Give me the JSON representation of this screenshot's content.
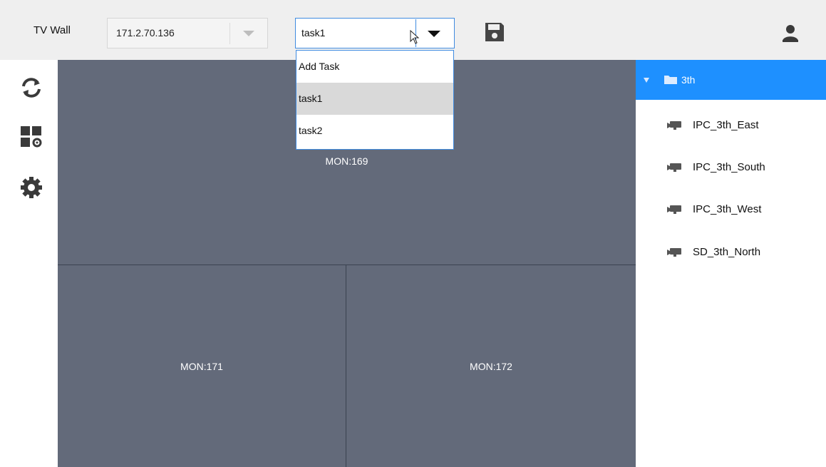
{
  "topbar": {
    "title": "TV Wall",
    "device_select_value": "171.2.70.136",
    "task_select_value": "task1",
    "save_icon": "save-icon",
    "user_icon": "user-icon"
  },
  "task_dropdown": {
    "options": [
      "Add Task",
      "task1",
      "task2"
    ],
    "selected": "task1"
  },
  "left_toolbar": {
    "icons": [
      "refresh-icon",
      "layout-settings-icon",
      "gear-icon"
    ]
  },
  "tv_wall": {
    "screens": [
      "MON:169",
      "MON:171",
      "MON:172"
    ]
  },
  "device_tree": {
    "root_label": "3th",
    "items": [
      "IPC_3th_East",
      "IPC_3th_South",
      "IPC_3th_West",
      "SD_3th_North"
    ]
  },
  "colors": {
    "accent": "#1e90ff",
    "wall_background": "#636a7a",
    "topbar_background": "#efefef",
    "dropdown_border": "#3f8be0"
  }
}
